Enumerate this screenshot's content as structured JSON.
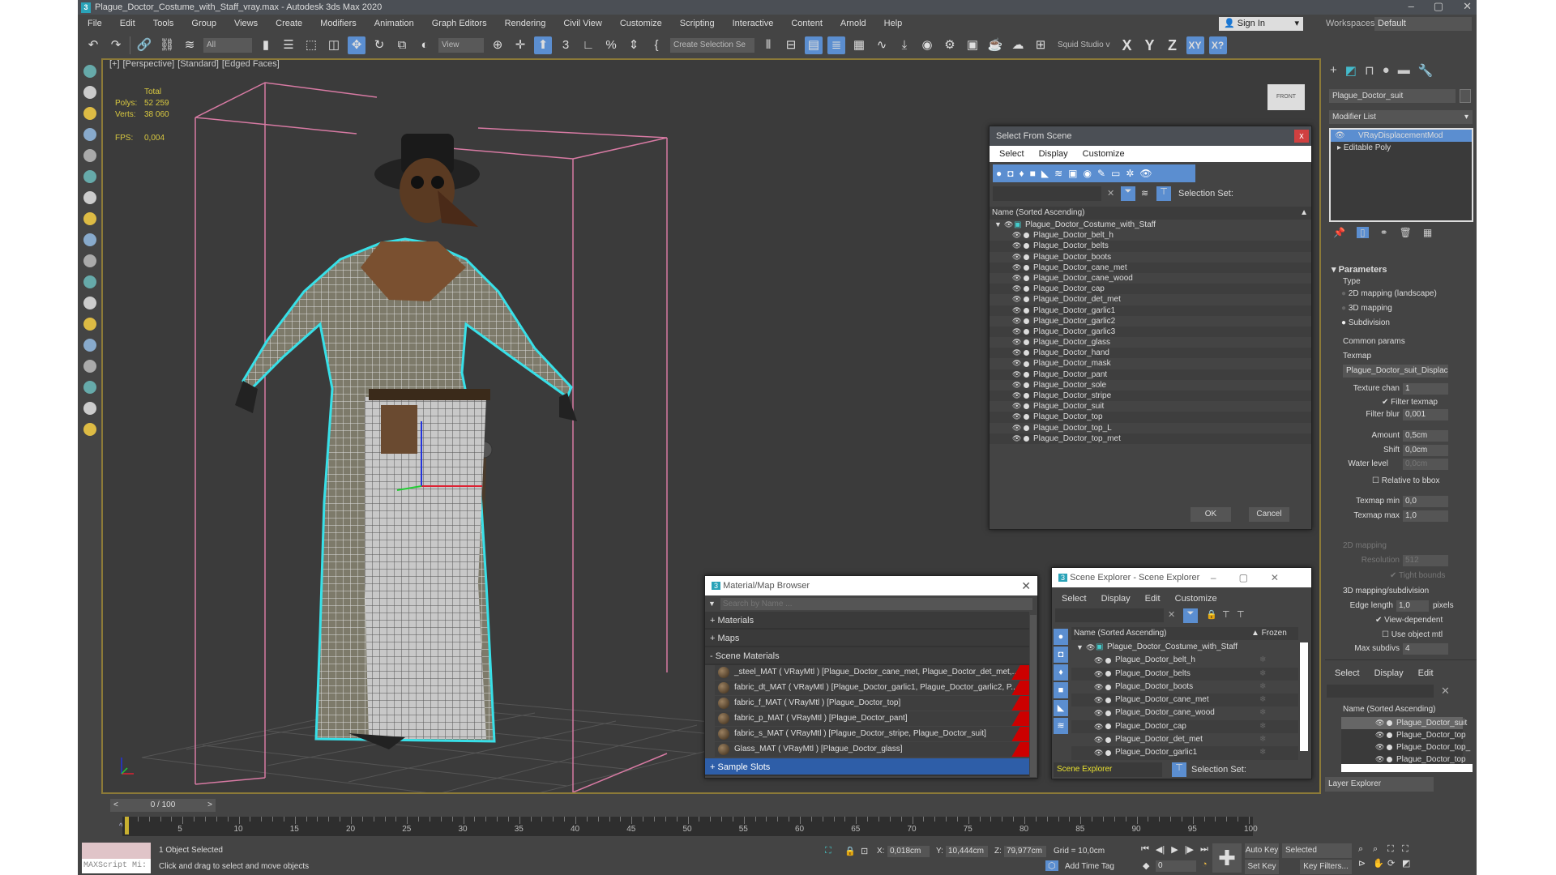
{
  "window": {
    "title": "Plague_Doctor_Costume_with_Staff_vray.max - Autodesk 3ds Max 2020",
    "app_icon": "3",
    "controls": [
      "–",
      "▢",
      "✕"
    ]
  },
  "menu": [
    "File",
    "Edit",
    "Tools",
    "Group",
    "Views",
    "Create",
    "Modifiers",
    "Animation",
    "Graph Editors",
    "Rendering",
    "Civil View",
    "Customize",
    "Scripting",
    "Interactive",
    "Content",
    "Arnold",
    "Help"
  ],
  "account": {
    "sign_in": "Sign In",
    "workspaces_label": "Workspaces:",
    "workspace": "Default"
  },
  "toolbar": {
    "filter": "All",
    "ref_coord": "View",
    "selection_set": "Create Selection Se",
    "studio": "Squid Studio v",
    "axes": [
      "X",
      "Y",
      "Z",
      "XY",
      "X?"
    ]
  },
  "viewport": {
    "labels": [
      "[+]",
      "[Perspective]",
      "[Standard]",
      "[Edged Faces]"
    ],
    "stats": {
      "total": "Total",
      "polys_label": "Polys:",
      "polys": "52 259",
      "verts_label": "Verts:",
      "verts": "38 060",
      "fps_label": "FPS:",
      "fps": "0,004"
    },
    "viewcube": "FRONT"
  },
  "select_from_scene": {
    "title": "Select From Scene",
    "close": "x",
    "menu": [
      "Select",
      "Display",
      "Customize"
    ],
    "selection_set": "Selection Set:",
    "column": "Name (Sorted Ascending)",
    "root": "Plague_Doctor_Costume_with_Staff",
    "items": [
      "Plague_Doctor_belt_h",
      "Plague_Doctor_belts",
      "Plague_Doctor_boots",
      "Plague_Doctor_cane_met",
      "Plague_Doctor_cane_wood",
      "Plague_Doctor_cap",
      "Plague_Doctor_det_met",
      "Plague_Doctor_garlic1",
      "Plague_Doctor_garlic2",
      "Plague_Doctor_garlic3",
      "Plague_Doctor_glass",
      "Plague_Doctor_hand",
      "Plague_Doctor_mask",
      "Plague_Doctor_pant",
      "Plague_Doctor_sole",
      "Plague_Doctor_stripe",
      "Plague_Doctor_suit",
      "Plague_Doctor_top",
      "Plague_Doctor_top_L",
      "Plague_Doctor_top_met"
    ],
    "ok": "OK",
    "cancel": "Cancel"
  },
  "material_browser": {
    "title": "Material/Map Browser",
    "search_placeholder": "Search by Name ...",
    "sections": [
      "+ Materials",
      "+ Maps",
      "- Scene Materials"
    ],
    "materials": [
      "_steel_MAT ( VRayMtl ) [Plague_Doctor_cane_met, Plague_Doctor_det_met,...",
      "fabric_dt_MAT ( VRayMtl ) [Plague_Doctor_garlic1, Plague_Doctor_garlic2, P...",
      "fabric_f_MAT ( VRayMtl ) [Plague_Doctor_top]",
      "fabric_p_MAT ( VRayMtl ) [Plague_Doctor_pant]",
      "fabric_s_MAT ( VRayMtl ) [Plague_Doctor_stripe, Plague_Doctor_suit]",
      "Glass_MAT ( VRayMtl ) [Plague_Doctor_glass]"
    ],
    "sample_slots": "+ Sample Slots"
  },
  "scene_explorer": {
    "title": "Scene Explorer - Scene Explorer",
    "menu": [
      "Select",
      "Display",
      "Edit",
      "Customize"
    ],
    "column": "Name (Sorted Ascending)",
    "frozen": "▲ Frozen",
    "root": "Plague_Doctor_Costume_with_Staff",
    "items": [
      "Plague_Doctor_belt_h",
      "Plague_Doctor_belts",
      "Plague_Doctor_boots",
      "Plague_Doctor_cane_met",
      "Plague_Doctor_cane_wood",
      "Plague_Doctor_cap",
      "Plague_Doctor_det_met",
      "Plague_Doctor_garlic1"
    ],
    "footer": "Scene Explorer",
    "selection_set": "Selection Set:"
  },
  "command_panel": {
    "object_name": "Plague_Doctor_suit",
    "modifier_list": "Modifier List",
    "stack": [
      "VRayDisplacementMod",
      "Editable Poly"
    ],
    "rollout": "Parameters",
    "type_group": "Type",
    "types": [
      "2D mapping (landscape)",
      "3D mapping",
      "Subdivision"
    ],
    "selected_type": "Subdivision",
    "common_group": "Common params",
    "texmap_label": "Texmap",
    "texmap": "Plague_Doctor_suit_Displacem",
    "texture_chan_label": "Texture chan",
    "texture_chan": "1",
    "filter_texmap": "Filter texmap",
    "filter_blur_label": "Filter blur",
    "filter_blur": "0,001",
    "amount_label": "Amount",
    "amount": "0,5cm",
    "shift_label": "Shift",
    "shift": "0,0cm",
    "water_label": "Water level",
    "water": "0,0cm",
    "relative_bbox": "Relative to bbox",
    "texmap_min_label": "Texmap min",
    "texmap_min": "0,0",
    "texmap_max_label": "Texmap max",
    "texmap_max": "1,0",
    "map2d_group": "2D mapping",
    "resolution_label": "Resolution",
    "resolution": "512",
    "tight_bounds": "Tight bounds",
    "map3d_group": "3D mapping/subdivision",
    "edge_length_label": "Edge length",
    "edge_length": "1,0",
    "pixels": "pixels",
    "view_dependent": "View-dependent",
    "use_object_mtl": "Use object mtl",
    "max_subdivs_label": "Max subdivs",
    "max_subdivs": "4"
  },
  "layer_explorer": {
    "menu": [
      "Select",
      "Display",
      "Edit"
    ],
    "column": "Name (Sorted Ascending)",
    "items": [
      "Plague_Doctor_suit",
      "Plague_Doctor_top",
      "Plague_Doctor_top_",
      "Plague_Doctor_top"
    ],
    "footer": "Layer Explorer"
  },
  "timeline": {
    "frame": "0 / 100",
    "start": 0,
    "end": 100,
    "current": 0
  },
  "status": {
    "maxscript": "MAXScript Mi:",
    "selected": "1 Object Selected",
    "prompt": "Click and drag to select and move objects",
    "x_label": "X:",
    "x": "0,018cm",
    "y_label": "Y:",
    "y": "10,444cm",
    "z_label": "Z:",
    "z": "79,977cm",
    "grid": "Grid = 10,0cm",
    "add_time_tag": "Add Time Tag",
    "frame": "0",
    "auto_key": "Auto Key",
    "key_mode": "Selected",
    "set_key": "Set Key",
    "key_filters": "Key Filters..."
  }
}
